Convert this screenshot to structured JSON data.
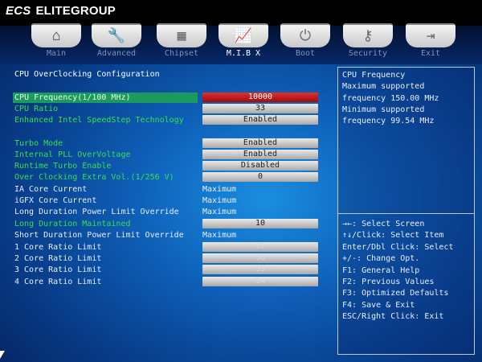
{
  "brand": {
    "mark": "ECS",
    "name": "ELITEGROUP"
  },
  "tabs": [
    {
      "label": "Main",
      "icon": "home-icon",
      "glyph": "⌂"
    },
    {
      "label": "Advanced",
      "icon": "wrench-icon",
      "glyph": "🔧"
    },
    {
      "label": "Chipset",
      "icon": "chip-icon",
      "glyph": "▦"
    },
    {
      "label": "M.I.B X",
      "icon": "chart-icon",
      "glyph": "📈",
      "active": true
    },
    {
      "label": "Boot",
      "icon": "power-icon",
      "glyph": "⏻"
    },
    {
      "label": "Security",
      "icon": "key-icon",
      "glyph": "⚷"
    },
    {
      "label": "Exit",
      "icon": "exit-door-icon",
      "glyph": "⇥"
    }
  ],
  "section_title": "CPU OverClocking Configuration",
  "settings": [
    {
      "label": "CPU Frequency(1/100 MHz)",
      "value": "10000"
    },
    {
      "label": "CPU Ratio",
      "value": "33"
    },
    {
      "label": "Enhanced Intel SpeedStep Technology",
      "value": "Enabled"
    },
    {
      "label": "Turbo Mode",
      "value": "Enabled"
    },
    {
      "label": "Internal PLL OverVoltage",
      "value": "Enabled"
    },
    {
      "label": "Runtime Turbo Enable",
      "value": "Disabled"
    },
    {
      "label": "Over Clocking Extra Vol.(1/256 V)",
      "value": "0"
    },
    {
      "label": "IA Core Current",
      "value": "Maximum"
    },
    {
      "label": "iGFX Core Current",
      "value": "Maximum"
    },
    {
      "label": "Long Duration Power Limit Override",
      "value": "Maximum"
    },
    {
      "label": "Long Duration Maintained",
      "value": "10"
    },
    {
      "label": "Short Duration Power Limit Override",
      "value": "Maximum"
    },
    {
      "label": "1 Core Ratio Limit",
      "value": "37"
    },
    {
      "label": "2 Core Ratio Limit",
      "value": "36"
    },
    {
      "label": "3 Core Ratio Limit",
      "value": "35"
    },
    {
      "label": "4 Core Ratio Limit",
      "value": "34"
    }
  ],
  "help": [
    "CPU Frequency",
    "Maximum supported",
    "frequency 150.00 MHz",
    "Minimum supported",
    "frequency 99.54 MHz"
  ],
  "keys": [
    "→←: Select Screen",
    "↑↓/Click: Select Item",
    "Enter/Dbl Click: Select",
    "+/-: Change Opt.",
    "F1: General Help",
    "F2: Previous Values",
    "F3: Optimized Defaults",
    "F4: Save & Exit",
    "ESC/Right Click: Exit"
  ],
  "colors": {
    "selected_row": "#1c9a5e",
    "selected_value": "#c01818",
    "editable_label": "#36e04a",
    "static_label": "#e8eef8"
  }
}
